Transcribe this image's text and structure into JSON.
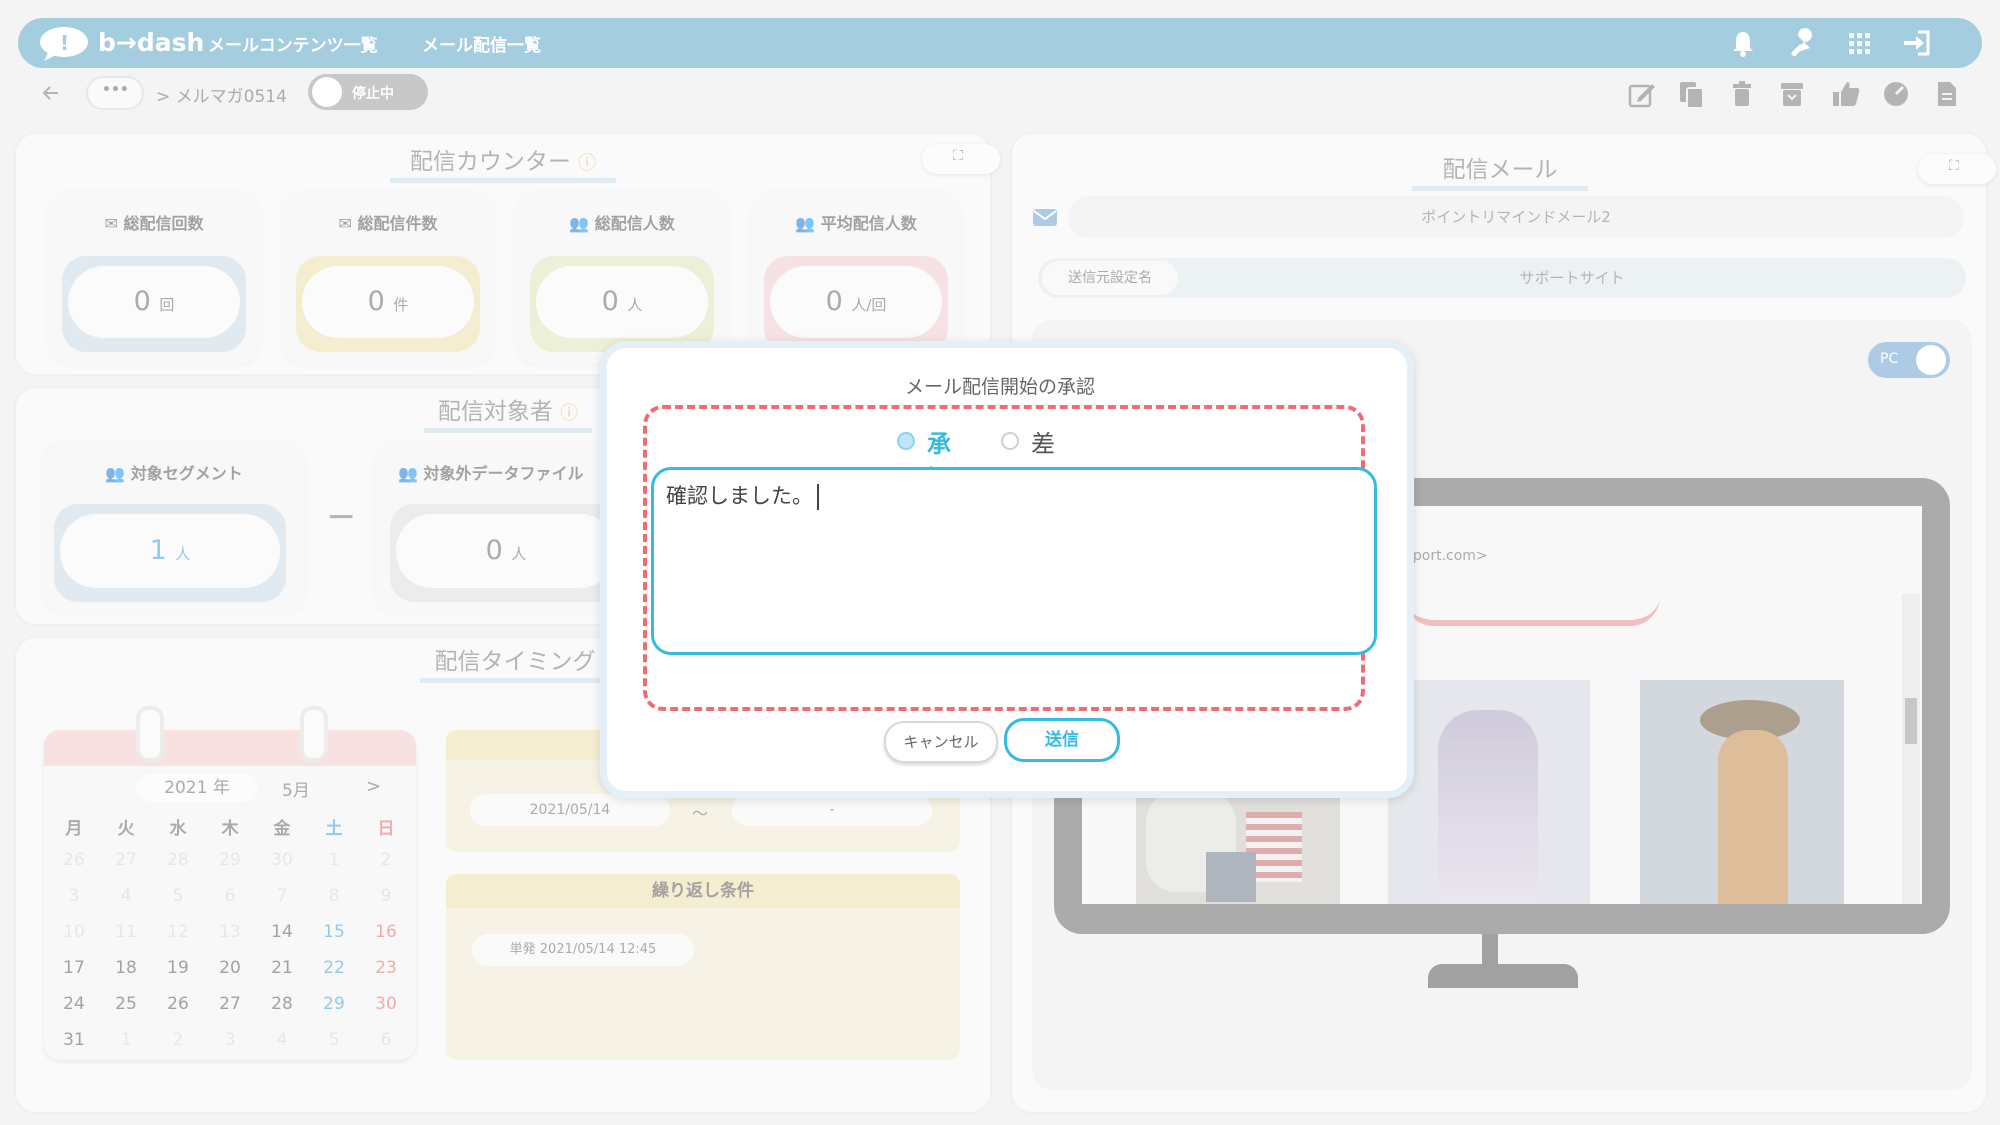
{
  "header": {
    "logo_text": "b→dash",
    "nav": [
      "メールコンテンツ一覧",
      "メール配信一覧"
    ]
  },
  "subbar": {
    "more": "•••",
    "breadcrumb": "> メルマガ0514",
    "status_toggle": "停止中"
  },
  "counter": {
    "title": "配信カウンター",
    "cards": [
      {
        "label": "総配信回数",
        "value": "0",
        "unit": "回"
      },
      {
        "label": "総配信件数",
        "value": "0",
        "unit": "件"
      },
      {
        "label": "総配信人数",
        "value": "0",
        "unit": "人"
      },
      {
        "label": "平均配信人数",
        "value": "0",
        "unit": "人/回"
      }
    ]
  },
  "targets": {
    "title": "配信対象者",
    "segment_label": "対象セグメント",
    "segment_value": "1",
    "segment_unit": "人",
    "minus": "−",
    "excluded_label": "対象外データファイル",
    "excluded_value": "0",
    "excluded_unit": "人"
  },
  "timing": {
    "title": "配信タイミング",
    "cal_year": "2021",
    "cal_year_suffix": "年",
    "cal_month": "5月",
    "cal_next": ">",
    "weekdays": [
      "月",
      "火",
      "水",
      "木",
      "金",
      "土",
      "日"
    ],
    "weeks": [
      [
        "26",
        "27",
        "28",
        "29",
        "30",
        "1",
        "2"
      ],
      [
        "3",
        "4",
        "5",
        "6",
        "7",
        "8",
        "9"
      ],
      [
        "10",
        "11",
        "12",
        "13",
        "14",
        "15",
        "16"
      ],
      [
        "17",
        "18",
        "19",
        "20",
        "21",
        "22",
        "23"
      ],
      [
        "24",
        "25",
        "26",
        "27",
        "28",
        "29",
        "30"
      ],
      [
        "31",
        "1",
        "2",
        "3",
        "4",
        "5",
        "6"
      ]
    ],
    "start_date": "2021/05/14",
    "tilde": "～",
    "end_date": "-",
    "repeat_title": "繰り返し条件",
    "repeat_value": "単発 2021/05/14 12:45"
  },
  "mail": {
    "title": "配信メール",
    "subject": "ポイントリマインドメール2",
    "sender_label": "送信元設定名",
    "sender_value": "サポートサイト",
    "device_toggle": "PC",
    "preview_from": "pport.com>"
  },
  "modal": {
    "title": "メール配信開始の承認",
    "option_approve": "承認",
    "option_reject": "差し戻し",
    "comment": "確認しました。",
    "cancel": "キャンセル",
    "send": "送信"
  },
  "colors": {
    "header": "#5aa7c7",
    "accent": "#36b9e2",
    "dashed_highlight": "#f06b74"
  }
}
